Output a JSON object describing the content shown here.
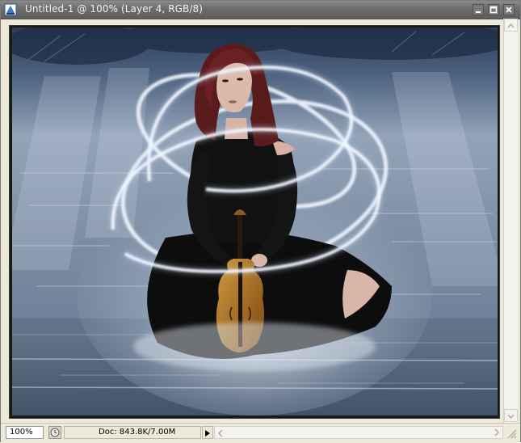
{
  "window": {
    "title": "Untitled-1 @ 100% (Layer 4, RGB/8)",
    "app_icon": "photoshop-document-icon",
    "buttons": [
      "minimize-icon",
      "maximize-icon",
      "close-icon"
    ]
  },
  "canvas": {
    "image": "woman-in-black-dress-with-violin-on-water-with-light-rings"
  },
  "status": {
    "zoom": "100%",
    "doc_info": "Doc: 843.8K/7.00M",
    "status_icon": "clock-icon",
    "menu_arrow": "triangle-right-icon"
  },
  "colors": {
    "titlebar": "#6c6c6c",
    "chrome": "#ece9d8",
    "water": "#8a9cb2",
    "dress": "#0e0e0e",
    "hair": "#5a1a1c",
    "rings": "#e8f2ff"
  }
}
